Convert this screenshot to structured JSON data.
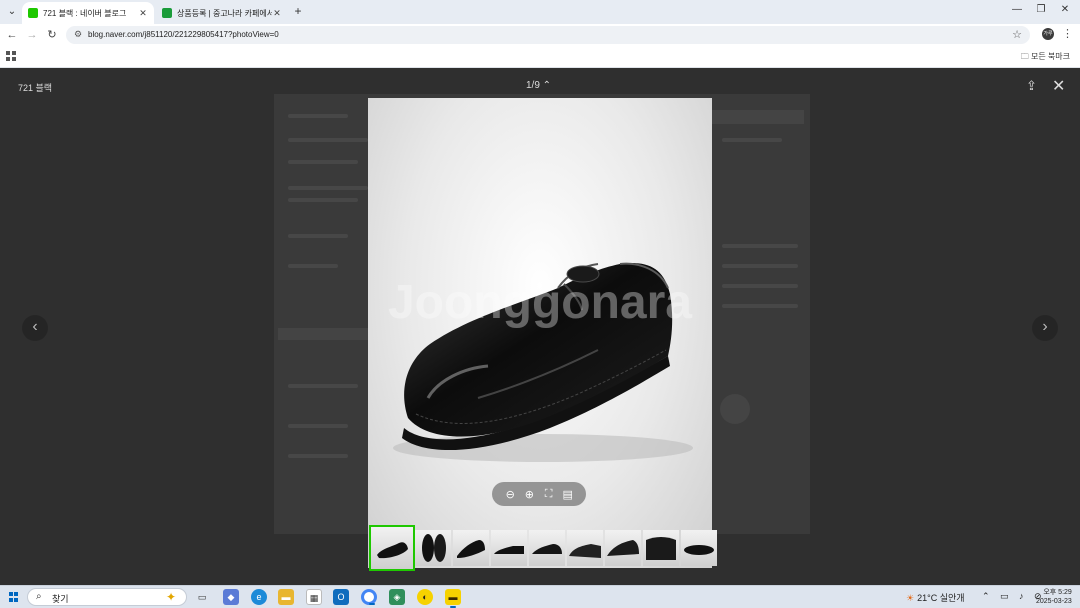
{
  "browser": {
    "tabs": [
      {
        "title": "721 블랙 : 네이버 블로그",
        "favicon_color": "#1ec800",
        "active": true
      },
      {
        "title": "상품등록 | 중고나라 카페에서",
        "favicon_color": "#1a9c3a",
        "active": false
      }
    ],
    "url": "blog.naver.com/j851120/221229805417?photoView=0",
    "profile_initials": "가루",
    "bookmarks_all_label": "모든 북마크"
  },
  "viewer": {
    "title": "721 블랙",
    "counter": "1/9 ⌃",
    "watermark": "Joonggonara",
    "thumbnail_count": 9,
    "selected_thumbnail": 1,
    "accent": "#1ec800"
  },
  "taskbar": {
    "search_placeholder": "찾기",
    "weather": "21°C 실안개",
    "time": "오후 5:29",
    "date": "2025-03-23"
  }
}
